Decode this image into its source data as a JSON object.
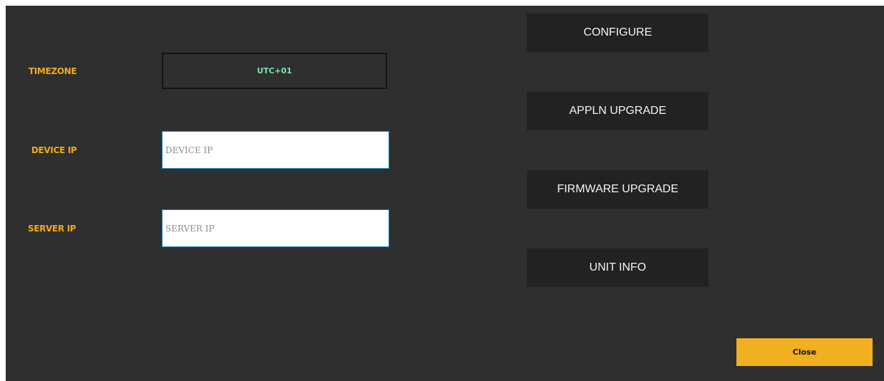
{
  "fields": {
    "timezone": {
      "label": "TIMEZONE",
      "value": "UTC+01"
    },
    "device_ip": {
      "label": "DEVICE IP",
      "placeholder": "DEVICE IP",
      "value": ""
    },
    "server_ip": {
      "label": "SERVER IP",
      "placeholder": "SERVER IP",
      "value": ""
    }
  },
  "actions": {
    "configure": "CONFIGURE",
    "appln_upgrade": "APPLN UPGRADE",
    "firmware_upgrade": "FIRMWARE UPGRADE",
    "unit_info": "UNIT INFO"
  },
  "footer": {
    "close_label": "Close"
  },
  "colors": {
    "panel_background": "#2f2f2f",
    "label_text": "#f0aa1e",
    "timezone_value": "#7ee8a2",
    "button_background": "#222222",
    "close_button_background": "#f0b020",
    "input_border": "#1d8ac0"
  }
}
